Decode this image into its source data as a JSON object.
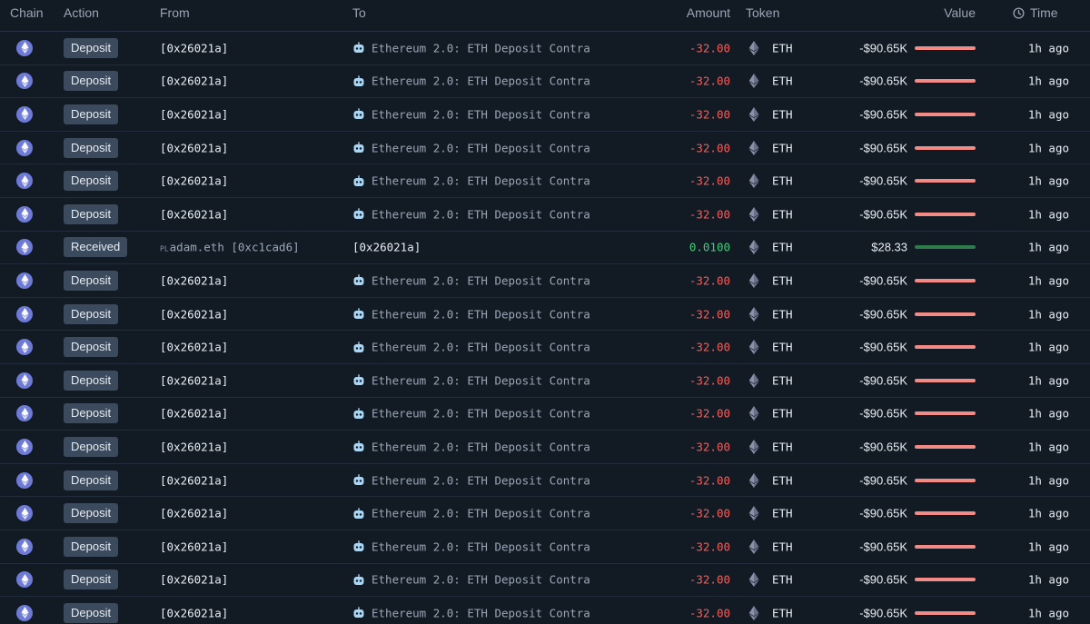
{
  "header": {
    "chain": "Chain",
    "action": "Action",
    "from": "From",
    "to": "To",
    "amount": "Amount",
    "token": "Token",
    "value": "Value",
    "time": "Time"
  },
  "colors": {
    "negative": "#f0605d",
    "positive": "#3ccf7a",
    "bar_negative": "#f28a86",
    "bar_positive": "#2f7a4a",
    "chain_icon": "#6e7bd6"
  },
  "icons": {
    "chain": "ethereum-icon",
    "contract": "robot-icon",
    "token": "eth-token-icon",
    "time": "clock-icon"
  },
  "rows": [
    {
      "action": "Deposit",
      "from_prefix": "",
      "from": "[0x26021a]",
      "to_icon": true,
      "to": "Ethereum 2.0: ETH Deposit Contra",
      "amount": "-32.00",
      "direction": "out",
      "token": "ETH",
      "value": "-$90.65K",
      "time": "1h ago"
    },
    {
      "action": "Deposit",
      "from_prefix": "",
      "from": "[0x26021a]",
      "to_icon": true,
      "to": "Ethereum 2.0: ETH Deposit Contra",
      "amount": "-32.00",
      "direction": "out",
      "token": "ETH",
      "value": "-$90.65K",
      "time": "1h ago"
    },
    {
      "action": "Deposit",
      "from_prefix": "",
      "from": "[0x26021a]",
      "to_icon": true,
      "to": "Ethereum 2.0: ETH Deposit Contra",
      "amount": "-32.00",
      "direction": "out",
      "token": "ETH",
      "value": "-$90.65K",
      "time": "1h ago"
    },
    {
      "action": "Deposit",
      "from_prefix": "",
      "from": "[0x26021a]",
      "to_icon": true,
      "to": "Ethereum 2.0: ETH Deposit Contra",
      "amount": "-32.00",
      "direction": "out",
      "token": "ETH",
      "value": "-$90.65K",
      "time": "1h ago"
    },
    {
      "action": "Deposit",
      "from_prefix": "",
      "from": "[0x26021a]",
      "to_icon": true,
      "to": "Ethereum 2.0: ETH Deposit Contra",
      "amount": "-32.00",
      "direction": "out",
      "token": "ETH",
      "value": "-$90.65K",
      "time": "1h ago"
    },
    {
      "action": "Deposit",
      "from_prefix": "",
      "from": "[0x26021a]",
      "to_icon": true,
      "to": "Ethereum 2.0: ETH Deposit Contra",
      "amount": "-32.00",
      "direction": "out",
      "token": "ETH",
      "value": "-$90.65K",
      "time": "1h ago"
    },
    {
      "action": "Received",
      "from_prefix": "PL",
      "from": "adam.eth [0xc1cad6]",
      "to_icon": false,
      "to": "[0x26021a]",
      "amount": "0.0100",
      "direction": "in",
      "token": "ETH",
      "value": "$28.33",
      "time": "1h ago"
    },
    {
      "action": "Deposit",
      "from_prefix": "",
      "from": "[0x26021a]",
      "to_icon": true,
      "to": "Ethereum 2.0: ETH Deposit Contra",
      "amount": "-32.00",
      "direction": "out",
      "token": "ETH",
      "value": "-$90.65K",
      "time": "1h ago"
    },
    {
      "action": "Deposit",
      "from_prefix": "",
      "from": "[0x26021a]",
      "to_icon": true,
      "to": "Ethereum 2.0: ETH Deposit Contra",
      "amount": "-32.00",
      "direction": "out",
      "token": "ETH",
      "value": "-$90.65K",
      "time": "1h ago"
    },
    {
      "action": "Deposit",
      "from_prefix": "",
      "from": "[0x26021a]",
      "to_icon": true,
      "to": "Ethereum 2.0: ETH Deposit Contra",
      "amount": "-32.00",
      "direction": "out",
      "token": "ETH",
      "value": "-$90.65K",
      "time": "1h ago"
    },
    {
      "action": "Deposit",
      "from_prefix": "",
      "from": "[0x26021a]",
      "to_icon": true,
      "to": "Ethereum 2.0: ETH Deposit Contra",
      "amount": "-32.00",
      "direction": "out",
      "token": "ETH",
      "value": "-$90.65K",
      "time": "1h ago"
    },
    {
      "action": "Deposit",
      "from_prefix": "",
      "from": "[0x26021a]",
      "to_icon": true,
      "to": "Ethereum 2.0: ETH Deposit Contra",
      "amount": "-32.00",
      "direction": "out",
      "token": "ETH",
      "value": "-$90.65K",
      "time": "1h ago"
    },
    {
      "action": "Deposit",
      "from_prefix": "",
      "from": "[0x26021a]",
      "to_icon": true,
      "to": "Ethereum 2.0: ETH Deposit Contra",
      "amount": "-32.00",
      "direction": "out",
      "token": "ETH",
      "value": "-$90.65K",
      "time": "1h ago"
    },
    {
      "action": "Deposit",
      "from_prefix": "",
      "from": "[0x26021a]",
      "to_icon": true,
      "to": "Ethereum 2.0: ETH Deposit Contra",
      "amount": "-32.00",
      "direction": "out",
      "token": "ETH",
      "value": "-$90.65K",
      "time": "1h ago"
    },
    {
      "action": "Deposit",
      "from_prefix": "",
      "from": "[0x26021a]",
      "to_icon": true,
      "to": "Ethereum 2.0: ETH Deposit Contra",
      "amount": "-32.00",
      "direction": "out",
      "token": "ETH",
      "value": "-$90.65K",
      "time": "1h ago"
    },
    {
      "action": "Deposit",
      "from_prefix": "",
      "from": "[0x26021a]",
      "to_icon": true,
      "to": "Ethereum 2.0: ETH Deposit Contra",
      "amount": "-32.00",
      "direction": "out",
      "token": "ETH",
      "value": "-$90.65K",
      "time": "1h ago"
    },
    {
      "action": "Deposit",
      "from_prefix": "",
      "from": "[0x26021a]",
      "to_icon": true,
      "to": "Ethereum 2.0: ETH Deposit Contra",
      "amount": "-32.00",
      "direction": "out",
      "token": "ETH",
      "value": "-$90.65K",
      "time": "1h ago"
    },
    {
      "action": "Deposit",
      "from_prefix": "",
      "from": "[0x26021a]",
      "to_icon": true,
      "to": "Ethereum 2.0: ETH Deposit Contra",
      "amount": "-32.00",
      "direction": "out",
      "token": "ETH",
      "value": "-$90.65K",
      "time": "1h ago"
    }
  ]
}
